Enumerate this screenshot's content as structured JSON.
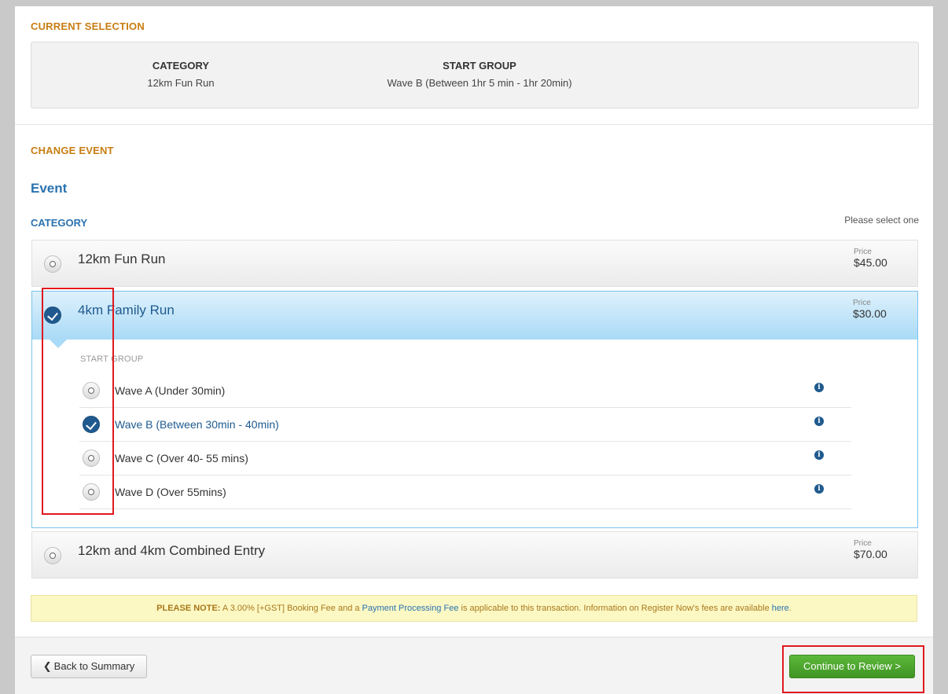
{
  "current_selection": {
    "heading": "CURRENT SELECTION",
    "category_header": "CATEGORY",
    "category_value": "12km Fun Run",
    "start_group_header": "START GROUP",
    "start_group_value": "Wave B (Between 1hr 5 min - 1hr 20min)"
  },
  "change_event": {
    "heading": "CHANGE EVENT",
    "event_title": "Event",
    "category_label": "CATEGORY",
    "please_select": "Please select one",
    "price_label": "Price",
    "categories": [
      {
        "name": "12km Fun Run",
        "price": "$45.00",
        "selected": false
      },
      {
        "name": "4km Family Run",
        "price": "$30.00",
        "selected": true
      },
      {
        "name": "12km and 4km Combined Entry",
        "price": "$70.00",
        "selected": false
      }
    ],
    "start_group_label": "START GROUP",
    "waves": [
      {
        "name": "Wave A (Under 30min)",
        "selected": false
      },
      {
        "name": "Wave B (Between 30min - 40min)",
        "selected": true
      },
      {
        "name": "Wave C (Over 40- 55 mins)",
        "selected": false
      },
      {
        "name": "Wave D (Over 55mins)",
        "selected": false
      }
    ],
    "info_icon_glyph": "i"
  },
  "note": {
    "prefix": "PLEASE NOTE:",
    "text1": " A 3.00% [+GST] Booking Fee and a ",
    "link1": "Payment Processing Fee",
    "text2": " is applicable to this transaction. Information on Register Now's fees are available ",
    "link2": "here",
    "text3": "."
  },
  "footer": {
    "back_chevron": "❮",
    "back_label": "Back to Summary",
    "continue_label": "Continue to Review >"
  },
  "colors": {
    "accent_orange": "#c87d12",
    "accent_blue": "#2a73b0",
    "checked_radio": "#1f5a8f",
    "continue_green": "#4caa2e",
    "highlight_red": "#e0191f"
  }
}
